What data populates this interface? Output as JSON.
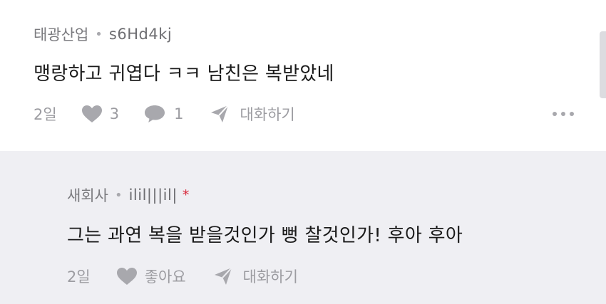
{
  "comments": [
    {
      "author": "태광산업",
      "user_id": "s6Hd4kj",
      "text": "맹랑하고 귀엽다 ㅋㅋ 남친은 복받았네",
      "time": "2일",
      "like_count": "3",
      "reply_count": "1",
      "reply_label": "대화하기"
    },
    {
      "author": "새회사",
      "user_id": "ilil|||il|",
      "author_marker": "*",
      "text": "그는 과연 복을 받을것인가 뻥 찰것인가! 후아 후아",
      "time": "2일",
      "like_label": "좋아요",
      "reply_label": "대화하기"
    }
  ],
  "colors": {
    "reply_background": "#efeff3",
    "icon_gray": "#a8a8ad",
    "author_marker": "#d8283a"
  },
  "icons": [
    "heart-icon",
    "speech-bubble-icon",
    "paper-plane-icon",
    "more-dots-icon"
  ]
}
